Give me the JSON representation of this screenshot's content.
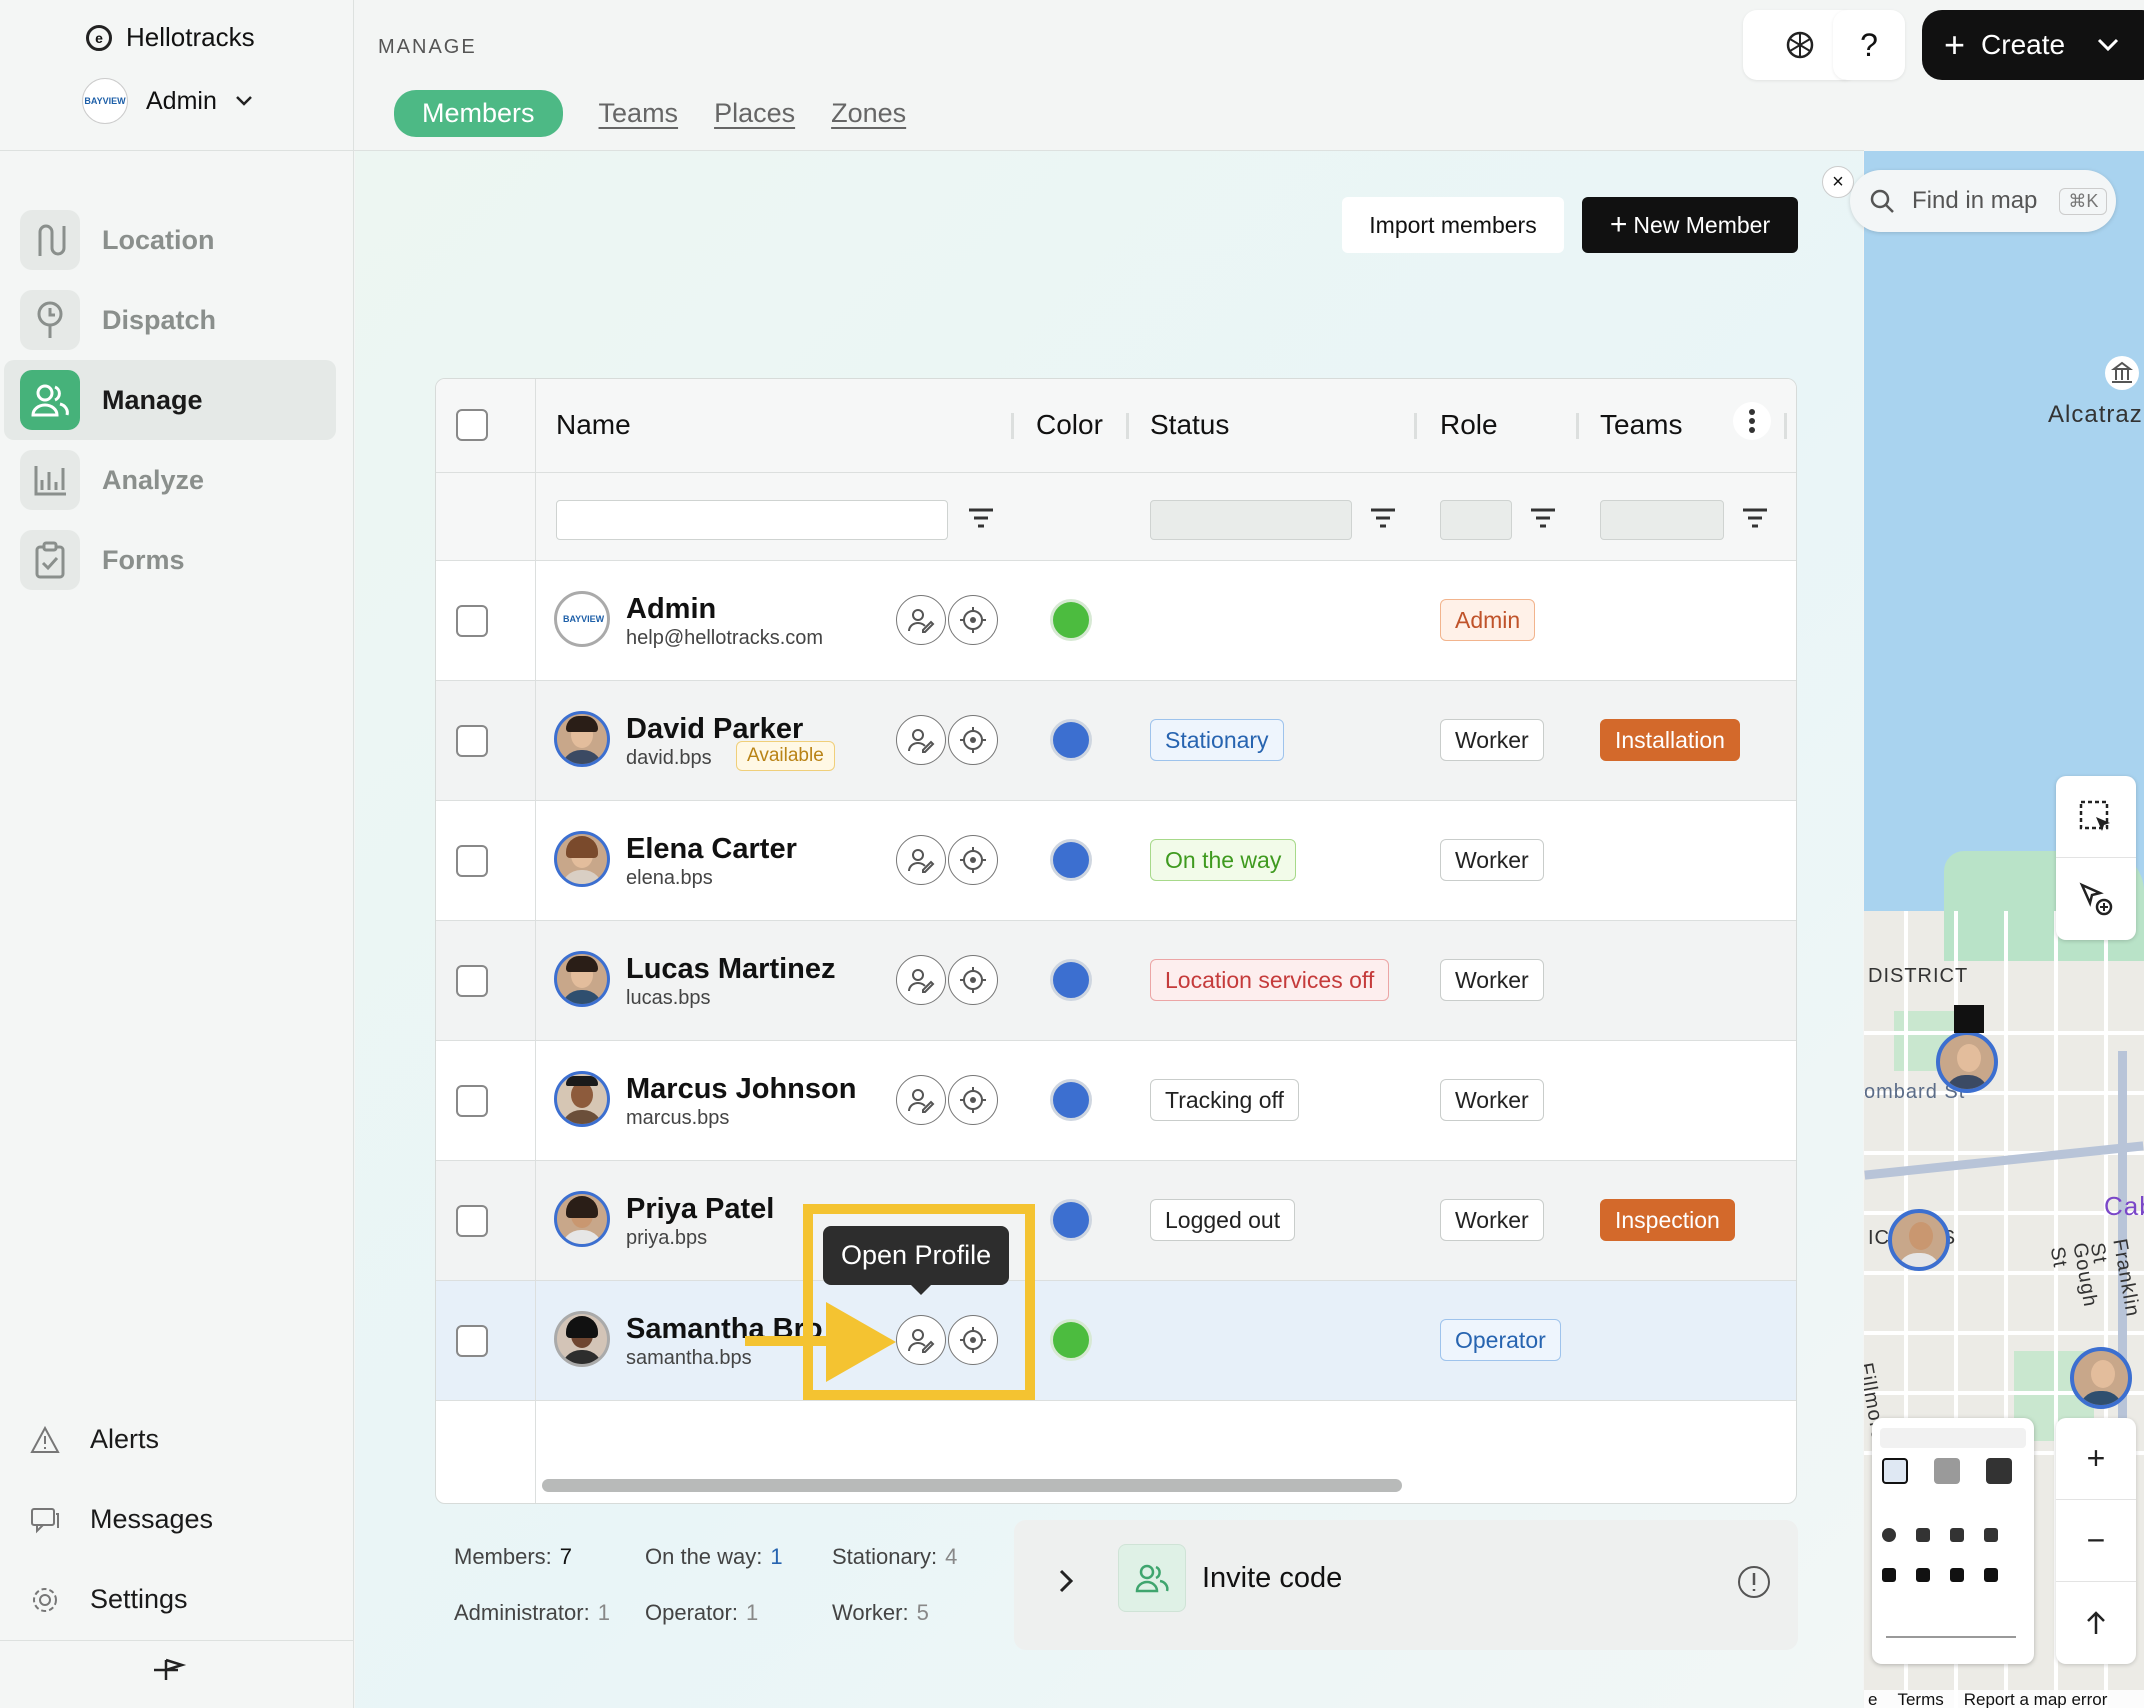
{
  "app": {
    "name": "Hellotracks",
    "account": "Admin"
  },
  "sidebar": {
    "items": [
      {
        "label": "Location",
        "icon": "route-icon"
      },
      {
        "label": "Dispatch",
        "icon": "dispatch-icon"
      },
      {
        "label": "Manage",
        "icon": "people-icon",
        "active": true
      },
      {
        "label": "Analyze",
        "icon": "chart-icon"
      },
      {
        "label": "Forms",
        "icon": "clipboard-icon"
      }
    ],
    "bottom": [
      {
        "label": "Alerts",
        "icon": "alert-icon"
      },
      {
        "label": "Messages",
        "icon": "messages-icon"
      },
      {
        "label": "Settings",
        "icon": "gear-icon"
      }
    ]
  },
  "header": {
    "section": "MANAGE",
    "tabs": [
      "Members",
      "Teams",
      "Places",
      "Zones"
    ],
    "help": "?",
    "create_label": "Create"
  },
  "toolbar": {
    "import_label": "Import members",
    "new_label": "New Member"
  },
  "table": {
    "columns": [
      "Name",
      "Color",
      "Status",
      "Role",
      "Teams"
    ],
    "rows": [
      {
        "name": "Admin",
        "sub": "help@hellotracks.com",
        "color": "#4cbc3f",
        "status": "",
        "role": "Admin",
        "team": ""
      },
      {
        "name": "David Parker",
        "sub": "david.bps",
        "extra": "Available",
        "color": "#3c6fd0",
        "status": "Stationary",
        "role": "Worker",
        "team": "Installation"
      },
      {
        "name": "Elena Carter",
        "sub": "elena.bps",
        "color": "#3c6fd0",
        "status": "On the way",
        "role": "Worker",
        "team": ""
      },
      {
        "name": "Lucas Martinez",
        "sub": "lucas.bps",
        "color": "#3c6fd0",
        "status": "Location services off",
        "role": "Worker",
        "team": ""
      },
      {
        "name": "Marcus Johnson",
        "sub": "marcus.bps",
        "color": "#3c6fd0",
        "status": "Tracking off",
        "role": "Worker",
        "team": ""
      },
      {
        "name": "Priya Patel",
        "sub": "priya.bps",
        "color": "#3c6fd0",
        "status": "Logged out",
        "role": "Worker",
        "team": "Inspection"
      },
      {
        "name": "Samantha Bro",
        "sub": "samantha.bps",
        "color": "#4cbc3f",
        "status": "",
        "role": "Operator",
        "team": ""
      }
    ]
  },
  "tooltip": "Open Profile",
  "stats": {
    "members_label": "Members:",
    "members": "7",
    "onway_label": "On the way:",
    "onway": "1",
    "stationary_label": "Stationary:",
    "stationary": "4",
    "admin_label": "Administrator:",
    "admin": "1",
    "operator_label": "Operator:",
    "operator": "1",
    "worker_label": "Worker:",
    "worker": "5"
  },
  "invite": {
    "label": "Invite code"
  },
  "map": {
    "search_placeholder": "Find in map",
    "shortcut": "⌘K",
    "labels": [
      "Alcatraz",
      "DISTRICT",
      "ombard St",
      "IC  GHTS",
      "Fillmore St",
      "Gough St",
      "Franklin St",
      "Cab"
    ],
    "footer": [
      "e",
      "Terms",
      "Report a map error"
    ],
    "zoom_in": "+",
    "zoom_out": "−"
  }
}
